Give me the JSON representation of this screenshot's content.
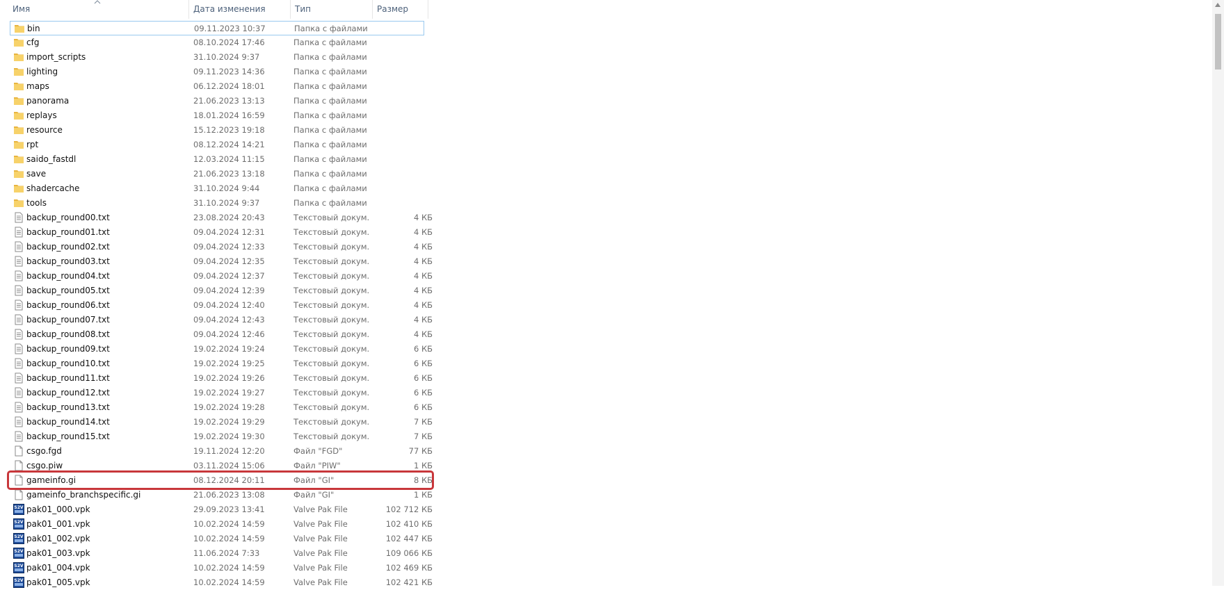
{
  "columns": {
    "name": "Имя",
    "date": "Дата изменения",
    "type": "Тип",
    "size": "Размер"
  },
  "colors": {
    "highlight": "#c8373b",
    "folder": "#f7d26a",
    "folder_dark": "#e8b43f",
    "vpk": "#1e4c9a"
  },
  "rows": [
    {
      "icon": "folder",
      "name": "bin",
      "date": "09.11.2023 10:37",
      "type": "Папка с файлами",
      "size": ""
    },
    {
      "icon": "folder",
      "name": "cfg",
      "date": "08.10.2024 17:46",
      "type": "Папка с файлами",
      "size": ""
    },
    {
      "icon": "folder",
      "name": "import_scripts",
      "date": "31.10.2024 9:37",
      "type": "Папка с файлами",
      "size": ""
    },
    {
      "icon": "folder",
      "name": "lighting",
      "date": "09.11.2023 14:36",
      "type": "Папка с файлами",
      "size": ""
    },
    {
      "icon": "folder",
      "name": "maps",
      "date": "06.12.2024 18:01",
      "type": "Папка с файлами",
      "size": ""
    },
    {
      "icon": "folder",
      "name": "panorama",
      "date": "21.06.2023 13:13",
      "type": "Папка с файлами",
      "size": ""
    },
    {
      "icon": "folder",
      "name": "replays",
      "date": "18.01.2024 16:59",
      "type": "Папка с файлами",
      "size": ""
    },
    {
      "icon": "folder",
      "name": "resource",
      "date": "15.12.2023 19:18",
      "type": "Папка с файлами",
      "size": ""
    },
    {
      "icon": "folder",
      "name": "rpt",
      "date": "08.12.2024 14:21",
      "type": "Папка с файлами",
      "size": ""
    },
    {
      "icon": "folder",
      "name": "saido_fastdl",
      "date": "12.03.2024 11:15",
      "type": "Папка с файлами",
      "size": ""
    },
    {
      "icon": "folder",
      "name": "save",
      "date": "21.06.2023 13:18",
      "type": "Папка с файлами",
      "size": ""
    },
    {
      "icon": "folder",
      "name": "shadercache",
      "date": "31.10.2024 9:44",
      "type": "Папка с файлами",
      "size": ""
    },
    {
      "icon": "folder",
      "name": "tools",
      "date": "31.10.2024 9:37",
      "type": "Папка с файлами",
      "size": ""
    },
    {
      "icon": "text",
      "name": "backup_round00.txt",
      "date": "23.08.2024 20:43",
      "type": "Текстовый докум...",
      "size": "4 КБ"
    },
    {
      "icon": "text",
      "name": "backup_round01.txt",
      "date": "09.04.2024 12:31",
      "type": "Текстовый докум...",
      "size": "4 КБ"
    },
    {
      "icon": "text",
      "name": "backup_round02.txt",
      "date": "09.04.2024 12:33",
      "type": "Текстовый докум...",
      "size": "4 КБ"
    },
    {
      "icon": "text",
      "name": "backup_round03.txt",
      "date": "09.04.2024 12:35",
      "type": "Текстовый докум...",
      "size": "4 КБ"
    },
    {
      "icon": "text",
      "name": "backup_round04.txt",
      "date": "09.04.2024 12:37",
      "type": "Текстовый докум...",
      "size": "4 КБ"
    },
    {
      "icon": "text",
      "name": "backup_round05.txt",
      "date": "09.04.2024 12:39",
      "type": "Текстовый докум...",
      "size": "4 КБ"
    },
    {
      "icon": "text",
      "name": "backup_round06.txt",
      "date": "09.04.2024 12:40",
      "type": "Текстовый докум...",
      "size": "4 КБ"
    },
    {
      "icon": "text",
      "name": "backup_round07.txt",
      "date": "09.04.2024 12:43",
      "type": "Текстовый докум...",
      "size": "4 КБ"
    },
    {
      "icon": "text",
      "name": "backup_round08.txt",
      "date": "09.04.2024 12:46",
      "type": "Текстовый докум...",
      "size": "4 КБ"
    },
    {
      "icon": "text",
      "name": "backup_round09.txt",
      "date": "19.02.2024 19:24",
      "type": "Текстовый докум...",
      "size": "6 КБ"
    },
    {
      "icon": "text",
      "name": "backup_round10.txt",
      "date": "19.02.2024 19:25",
      "type": "Текстовый докум...",
      "size": "6 КБ"
    },
    {
      "icon": "text",
      "name": "backup_round11.txt",
      "date": "19.02.2024 19:26",
      "type": "Текстовый докум...",
      "size": "6 КБ"
    },
    {
      "icon": "text",
      "name": "backup_round12.txt",
      "date": "19.02.2024 19:27",
      "type": "Текстовый докум...",
      "size": "6 КБ"
    },
    {
      "icon": "text",
      "name": "backup_round13.txt",
      "date": "19.02.2024 19:28",
      "type": "Текстовый докум...",
      "size": "6 КБ"
    },
    {
      "icon": "text",
      "name": "backup_round14.txt",
      "date": "19.02.2024 19:29",
      "type": "Текстовый докум...",
      "size": "7 КБ"
    },
    {
      "icon": "text",
      "name": "backup_round15.txt",
      "date": "19.02.2024 19:30",
      "type": "Текстовый докум...",
      "size": "7 КБ"
    },
    {
      "icon": "file",
      "name": "csgo.fgd",
      "date": "19.11.2024 12:20",
      "type": "Файл \"FGD\"",
      "size": "77 КБ"
    },
    {
      "icon": "file",
      "name": "csgo.piw",
      "date": "03.11.2024 15:06",
      "type": "Файл \"PIW\"",
      "size": "1 КБ"
    },
    {
      "icon": "file",
      "name": "gameinfo.gi",
      "date": "08.12.2024 20:11",
      "type": "Файл \"GI\"",
      "size": "8 КБ"
    },
    {
      "icon": "file",
      "name": "gameinfo_branchspecific.gi",
      "date": "21.06.2023 13:08",
      "type": "Файл \"GI\"",
      "size": "1 КБ"
    },
    {
      "icon": "vpk",
      "name": "pak01_000.vpk",
      "date": "29.09.2023 13:41",
      "type": "Valve Pak File",
      "size": "102 712 КБ"
    },
    {
      "icon": "vpk",
      "name": "pak01_001.vpk",
      "date": "10.02.2024 14:59",
      "type": "Valve Pak File",
      "size": "102 410 КБ"
    },
    {
      "icon": "vpk",
      "name": "pak01_002.vpk",
      "date": "10.02.2024 14:59",
      "type": "Valve Pak File",
      "size": "102 447 КБ"
    },
    {
      "icon": "vpk",
      "name": "pak01_003.vpk",
      "date": "11.06.2024 7:33",
      "type": "Valve Pak File",
      "size": "109 066 КБ"
    },
    {
      "icon": "vpk",
      "name": "pak01_004.vpk",
      "date": "10.02.2024 14:59",
      "type": "Valve Pak File",
      "size": "102 469 КБ"
    },
    {
      "icon": "vpk",
      "name": "pak01_005.vpk",
      "date": "10.02.2024 14:59",
      "type": "Valve Pak File",
      "size": "102 421 КБ"
    }
  ],
  "vpk_badge": "S2V"
}
